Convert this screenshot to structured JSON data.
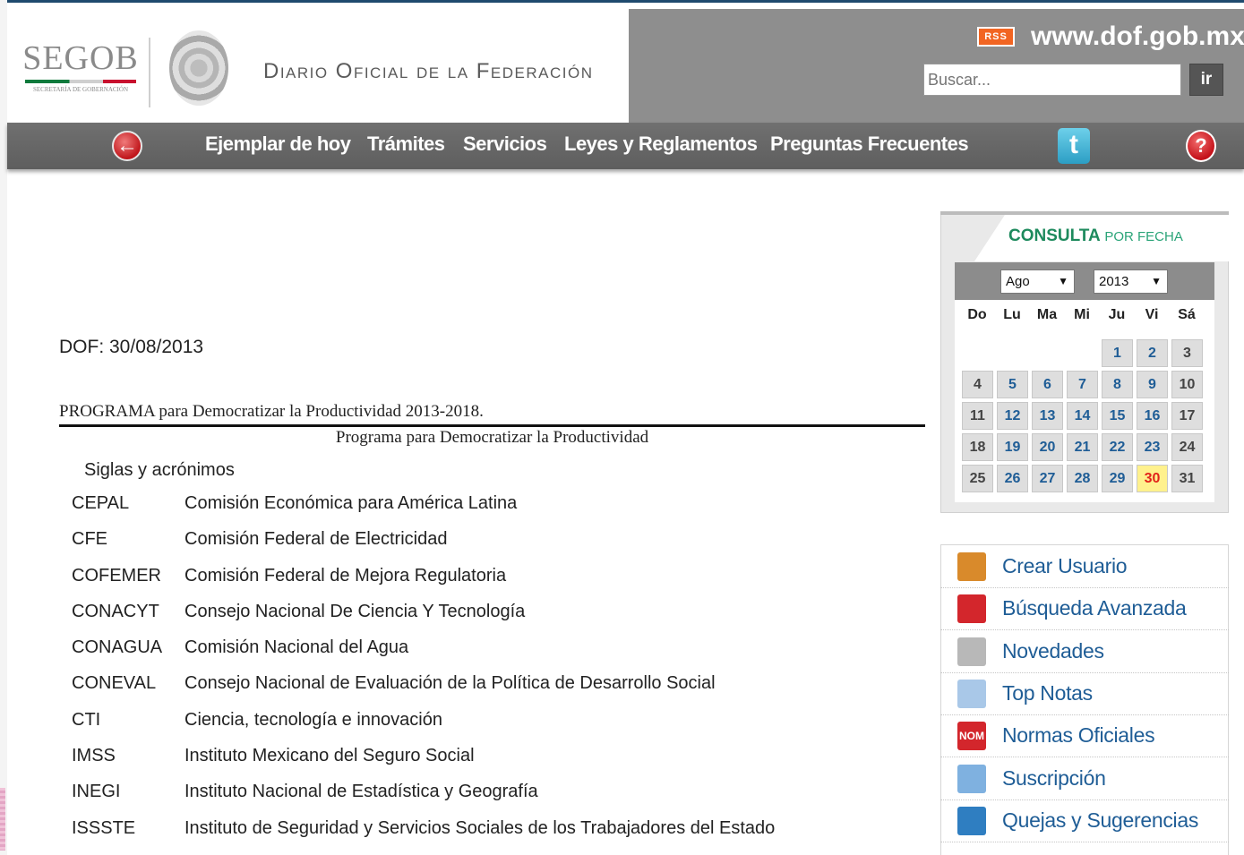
{
  "header": {
    "segob_logo": "SEGOB",
    "segob_subtitle": "SECRETARÍA DE GOBERNACIÓN",
    "title": "Diario Oficial de la Federación",
    "rss_label": "RSS",
    "site_url": "www.dof.gob.mx",
    "search_placeholder": "Buscar...",
    "search_button": "ir"
  },
  "nav": {
    "items": [
      "Ejemplar de hoy",
      "Trámites",
      "Servicios",
      "Leyes y Reglamentos",
      "Preguntas Frecuentes"
    ],
    "back_icon": "back-arrow-icon",
    "twitter_icon": "twitter-icon",
    "help_icon": "help-icon"
  },
  "content": {
    "dof_date": "DOF: 30/08/2013",
    "program_title": "PROGRAMA para Democratizar la Productividad 2013-2018.",
    "program_subtitle": "Programa para Democratizar la Productividad",
    "siglas_heading": "Siglas y acrónimos",
    "acronyms": [
      {
        "code": "CEPAL",
        "name": "Comisión Económica para América Latina"
      },
      {
        "code": "CFE",
        "name": "Comisión Federal de Electricidad"
      },
      {
        "code": "COFEMER",
        "name": "Comisión Federal de Mejora Regulatoria"
      },
      {
        "code": "CONACYT",
        "name": "Consejo Nacional De Ciencia Y Tecnología"
      },
      {
        "code": "CONAGUA",
        "name": "Comisión Nacional del Agua"
      },
      {
        "code": "CONEVAL",
        "name": "Consejo Nacional de Evaluación de la Política de Desarrollo Social"
      },
      {
        "code": "CTI",
        "name": "Ciencia, tecnología e innovación"
      },
      {
        "code": "IMSS",
        "name": "Instituto Mexicano del Seguro Social"
      },
      {
        "code": "INEGI",
        "name": "Instituto Nacional de Estadística y Geografía"
      },
      {
        "code": "ISSSTE",
        "name": "Instituto de Seguridad y Servicios Sociales de los Trabajadores del Estado"
      }
    ]
  },
  "calendar": {
    "heading": "CONSULTA",
    "heading_sub": "POR FECHA",
    "month": "Ago",
    "year": "2013",
    "weekdays": [
      "Do",
      "Lu",
      "Ma",
      "Mi",
      "Ju",
      "Vi",
      "Sá"
    ],
    "weeks": [
      [
        "",
        "",
        "",
        "",
        "1",
        "2",
        "3"
      ],
      [
        "4",
        "5",
        "6",
        "7",
        "8",
        "9",
        "10"
      ],
      [
        "11",
        "12",
        "13",
        "14",
        "15",
        "16",
        "17"
      ],
      [
        "18",
        "19",
        "20",
        "21",
        "22",
        "23",
        "24"
      ],
      [
        "25",
        "26",
        "27",
        "28",
        "29",
        "30",
        "31"
      ]
    ],
    "selected_day": "30"
  },
  "sidebar_links": [
    {
      "label": "Crear Usuario",
      "icon": "user-add-icon",
      "color": "#d98a2b"
    },
    {
      "label": "Búsqueda Avanzada",
      "icon": "search-icon",
      "color": "#d3262c"
    },
    {
      "label": "Novedades",
      "icon": "document-icon",
      "color": "#b8b8b8"
    },
    {
      "label": "Top Notas",
      "icon": "star-icon",
      "color": "#a9c8e8"
    },
    {
      "label": "Normas Oficiales",
      "icon": "nom-icon",
      "icon_text": "NOM",
      "color": "#d3262c"
    },
    {
      "label": "Suscripción",
      "icon": "pencil-note-icon",
      "color": "#7fb1e0"
    },
    {
      "label": "Quejas y Sugerencias",
      "icon": "mailbox-icon",
      "color": "#2f7ec1"
    }
  ]
}
